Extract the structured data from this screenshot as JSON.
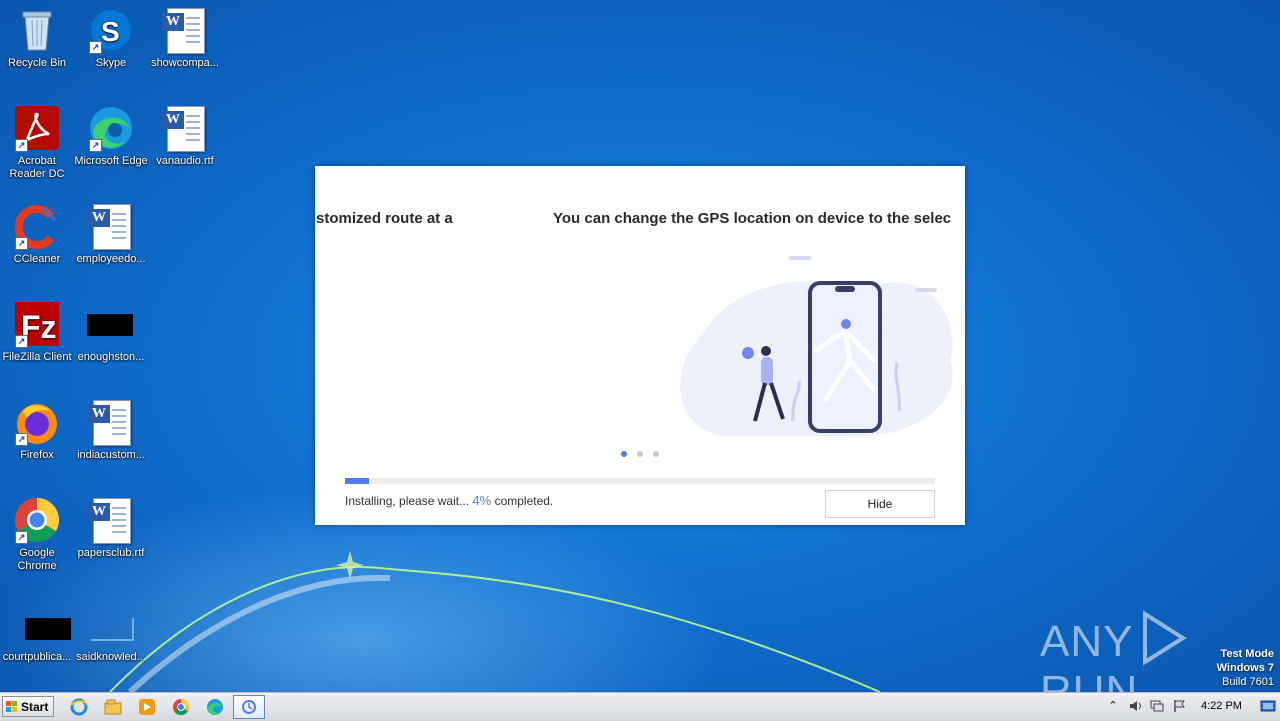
{
  "desktop": {
    "icons": [
      {
        "label": "Recycle Bin"
      },
      {
        "label": "Skype"
      },
      {
        "label": "showcompa..."
      },
      {
        "label": "Acrobat Reader DC"
      },
      {
        "label": "Microsoft Edge"
      },
      {
        "label": "vanaudio.rtf"
      },
      {
        "label": "CCleaner"
      },
      {
        "label": "employeedo..."
      },
      {
        "label": "FileZilla Client"
      },
      {
        "label": "enoughston..."
      },
      {
        "label": "Firefox"
      },
      {
        "label": "indiacustom..."
      },
      {
        "label": "Google Chrome"
      },
      {
        "label": "papersclub.rtf"
      },
      {
        "label": "courtpublica..."
      },
      {
        "label": "saidknowled..."
      }
    ]
  },
  "installer": {
    "slide_text_left": "stomized route at a",
    "slide_text_right": "You can change the GPS location on device to the selec",
    "progress_fraction": 0.04,
    "status_prefix": "Installing, please wait...",
    "status_percent": "4%",
    "status_suffix": "completed.",
    "hide_label": "Hide",
    "carousel_active_index": 0,
    "accent_color": "#4f7df1"
  },
  "watermark": {
    "brand_left": "ANY",
    "brand_right": "RUN",
    "line1": "Test Mode",
    "line2": "Windows 7",
    "line3": "Build 7601"
  },
  "taskbar": {
    "start_label": "Start",
    "pinned": [
      "internet-explorer-icon",
      "explorer-icon",
      "media-player-icon",
      "chrome-icon",
      "edge-icon",
      "installer-app-icon"
    ],
    "clock": "4:22 PM"
  }
}
